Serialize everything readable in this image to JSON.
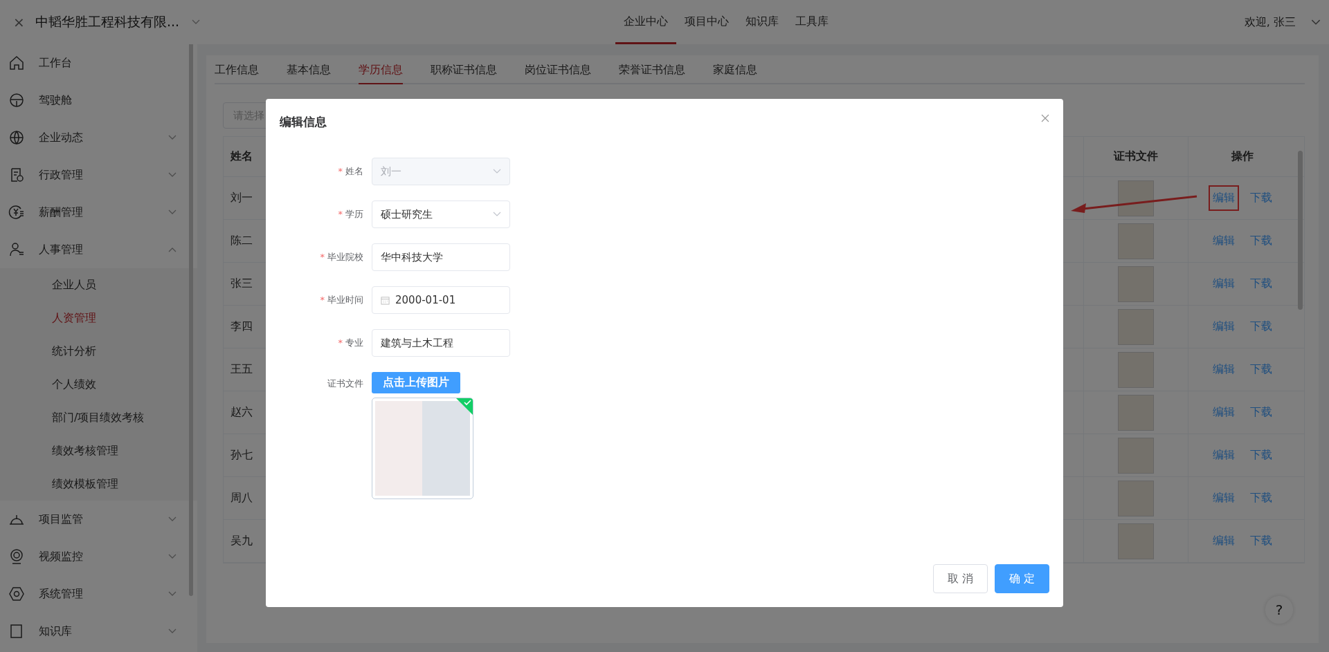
{
  "header": {
    "close": "×",
    "company": "中韬华胜工程科技有限...",
    "nav": [
      {
        "label": "企业中心",
        "selected": true
      },
      {
        "label": "项目中心",
        "selected": false
      },
      {
        "label": "知识库",
        "selected": false
      },
      {
        "label": "工具库",
        "selected": false
      }
    ],
    "welcome": "欢迎, 张三"
  },
  "sidebar": {
    "items": [
      {
        "label": "工作台"
      },
      {
        "label": "驾驶舱"
      },
      {
        "label": "企业动态",
        "expanded": false
      },
      {
        "label": "行政管理",
        "expanded": false
      },
      {
        "label": "薪酬管理",
        "expanded": false
      },
      {
        "label": "人事管理",
        "expanded": true,
        "children": [
          {
            "label": "企业人员",
            "selected": false
          },
          {
            "label": "人资管理",
            "selected": true
          },
          {
            "label": "统计分析",
            "selected": false
          },
          {
            "label": "个人绩效",
            "selected": false
          },
          {
            "label": "部门/项目绩效考核",
            "selected": false
          },
          {
            "label": "绩效考核管理",
            "selected": false
          },
          {
            "label": "绩效模板管理",
            "selected": false
          }
        ]
      },
      {
        "label": "项目监管",
        "expanded": false
      },
      {
        "label": "视频监控",
        "expanded": false
      },
      {
        "label": "系统管理",
        "expanded": false
      },
      {
        "label": "知识库",
        "expanded": false
      }
    ]
  },
  "tabs": [
    {
      "label": "工作信息",
      "selected": false
    },
    {
      "label": "基本信息",
      "selected": false
    },
    {
      "label": "学历信息",
      "selected": true
    },
    {
      "label": "职称证书信息",
      "selected": false
    },
    {
      "label": "岗位证书信息",
      "selected": false
    },
    {
      "label": "荣誉证书信息",
      "selected": false
    },
    {
      "label": "家庭信息",
      "selected": false
    }
  ],
  "search": {
    "placeholder": "请选择"
  },
  "table": {
    "columns": [
      "姓名",
      "证书文件",
      "操作"
    ],
    "rows": [
      {
        "name": "刘一",
        "actions": [
          "编辑",
          "下载"
        ],
        "highlighted": true
      },
      {
        "name": "陈二",
        "actions": [
          "编辑",
          "下载"
        ],
        "highlighted": false
      },
      {
        "name": "张三",
        "actions": [
          "编辑",
          "下载"
        ],
        "highlighted": false
      },
      {
        "name": "李四",
        "actions": [
          "编辑",
          "下载"
        ],
        "highlighted": false
      },
      {
        "name": "王五",
        "actions": [
          "编辑",
          "下载"
        ],
        "highlighted": false
      },
      {
        "name": "赵六",
        "actions": [
          "编辑",
          "下载"
        ],
        "highlighted": false
      },
      {
        "name": "孙七",
        "actions": [
          "编辑",
          "下载"
        ],
        "highlighted": false
      },
      {
        "name": "周八",
        "actions": [
          "编辑",
          "下载"
        ],
        "highlighted": false
      },
      {
        "name": "吴九",
        "actions": [
          "编辑",
          "下载"
        ],
        "highlighted": false
      }
    ]
  },
  "help": "?",
  "dialog": {
    "title": "编辑信息",
    "required_mark": "*",
    "fields": [
      {
        "label": "姓名",
        "required": true,
        "kind": "select",
        "value": "刘一",
        "disabled": true
      },
      {
        "label": "学历",
        "required": true,
        "kind": "select",
        "value": "硕士研究生",
        "disabled": false
      },
      {
        "label": "毕业院校",
        "required": true,
        "kind": "text",
        "value": "华中科技大学",
        "disabled": false
      },
      {
        "label": "毕业时间",
        "required": true,
        "kind": "date",
        "value": "2000-01-01",
        "disabled": false
      },
      {
        "label": "专业",
        "required": true,
        "kind": "text",
        "value": "建筑与土木工程",
        "disabled": false
      }
    ],
    "upload": {
      "label": "证书文件",
      "button": "点击上传图片",
      "uploaded": true
    },
    "cancel": "取 消",
    "confirm": "确 定"
  }
}
